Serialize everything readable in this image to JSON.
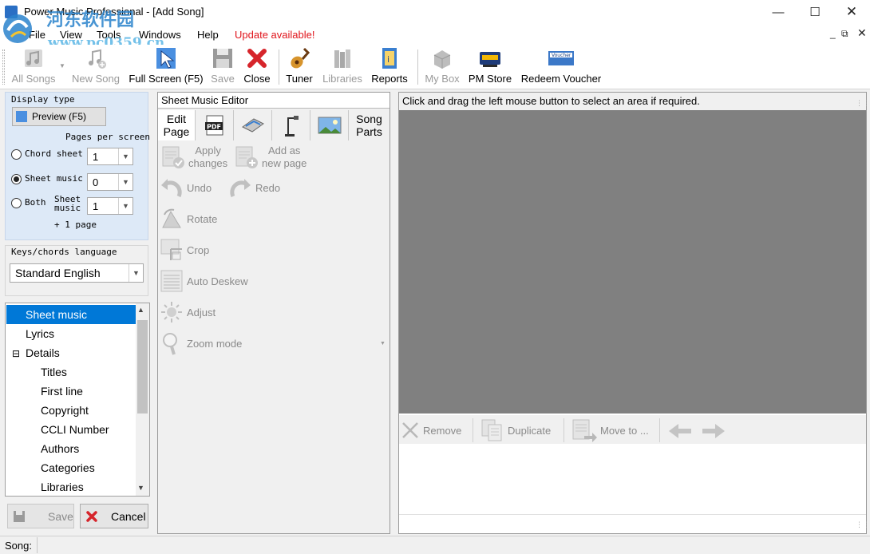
{
  "window": {
    "title": "Power Music Professional - [Add Song]",
    "watermark_top": "河东软件园",
    "watermark_bottom": "www.pc0359.cn"
  },
  "menu": [
    "File",
    "View",
    "Tools",
    "Windows",
    "Help"
  ],
  "update_notice": "Update available!",
  "toolbar": {
    "all_songs": "All Songs",
    "new_song": "New Song",
    "full_screen": "Full Screen (F5)",
    "save": "Save",
    "close": "Close",
    "tuner": "Tuner",
    "libraries": "Libraries",
    "reports": "Reports",
    "my_box": "My Box",
    "pm_store": "PM Store",
    "redeem_voucher": "Redeem Voucher",
    "voucher_icon_text": "Voucher"
  },
  "display": {
    "title": "Display type",
    "preview_button": "Preview (F5)",
    "pages_per_screen": "Pages per screen",
    "chord_label": "Chord sheet",
    "chord_value": "1",
    "sheet_label": "Sheet music",
    "sheet_value": "0",
    "both_label": "Both",
    "both_sub_1": "Sheet",
    "both_sub_2": "music",
    "both_value": "1",
    "plus_page": "+ 1 page",
    "selected": "Sheet music"
  },
  "keys": {
    "title": "Keys/chords language",
    "value": "Standard English"
  },
  "tree": {
    "items": [
      {
        "label": "Sheet music",
        "selected": true
      },
      {
        "label": "Lyrics"
      },
      {
        "label": "Details",
        "expander": "⊟"
      },
      {
        "label": "Titles"
      },
      {
        "label": "First line"
      },
      {
        "label": "Copyright"
      },
      {
        "label": "CCLI Number"
      },
      {
        "label": "Authors"
      },
      {
        "label": "Categories"
      },
      {
        "label": "Libraries"
      }
    ]
  },
  "buttons": {
    "save": "Save",
    "cancel": "Cancel"
  },
  "editor": {
    "title": "Sheet Music Editor",
    "tab_edit_1": "Edit",
    "tab_edit_2": "Page",
    "tab_pdf": "PDF",
    "tab_song_1": "Song",
    "tab_song_2": "Parts",
    "apply_1": "Apply",
    "apply_2": "changes",
    "add_1": "Add as",
    "add_2": "new page",
    "undo": "Undo",
    "redo": "Redo",
    "rotate": "Rotate",
    "crop": "Crop",
    "deskew": "Auto Deskew",
    "adjust": "Adjust",
    "zoom": "Zoom mode"
  },
  "canvas": {
    "hint": "Click and drag the left mouse button to select an area if required.",
    "remove": "Remove",
    "duplicate": "Duplicate",
    "move_to": "Move to ..."
  },
  "status": {
    "label": "Song:"
  },
  "colors": {
    "accent": "#0078d7",
    "update": "#e0151c",
    "panel": "#dde9f7",
    "canvas": "#808080"
  }
}
